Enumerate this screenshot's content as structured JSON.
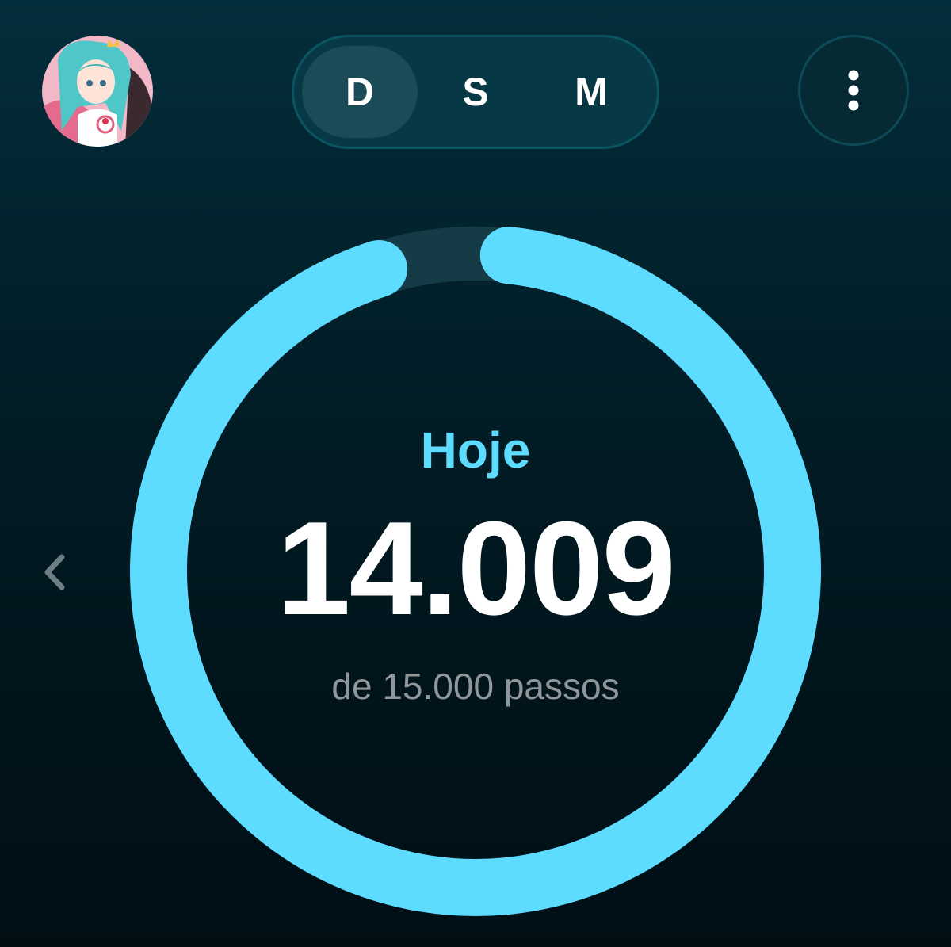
{
  "header": {
    "avatar_icon": "profile-avatar-anime-girl",
    "periods": [
      {
        "label": "D",
        "selected": true
      },
      {
        "label": "S",
        "selected": false
      },
      {
        "label": "M",
        "selected": false
      }
    ],
    "more_icon": "more-vertical-icon"
  },
  "navigation": {
    "prev_icon": "chevron-left-icon"
  },
  "summary": {
    "period_label": "Hoje",
    "steps_value": "14.009",
    "goal_text": "de 15.000 passos",
    "progress_fraction": 0.934
  },
  "colors": {
    "accent": "#5ddcff",
    "ring_track": "#153b46",
    "background_top": "#032e3b",
    "background_bottom": "#010f15"
  }
}
